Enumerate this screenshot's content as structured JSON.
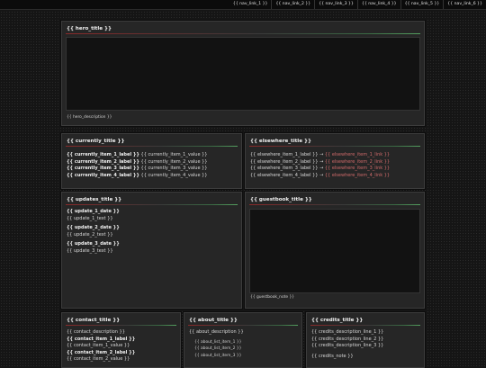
{
  "nav": [
    "{{ nav_link_1 }}",
    "{{ nav_link_2 }}",
    "{{ nav_link_3 }}",
    "{{ nav_link_4 }}",
    "{{ nav_link_5 }}",
    "{{ nav_link_6 }}"
  ],
  "hero": {
    "title": "{{ hero_title }}",
    "description": "{{ hero_description }}"
  },
  "currently": {
    "title": "{{ currently_title }}",
    "items": [
      {
        "label": "{{ currently_item_1_label }}",
        "value": "{{ currently_item_1_value }}"
      },
      {
        "label": "{{ currently_item_2_label }}",
        "value": "{{ currently_item_2_value }}"
      },
      {
        "label": "{{ currently_item_3_label }}",
        "value": "{{ currently_item_3_value }}"
      },
      {
        "label": "{{ currently_item_4_label }}",
        "value": "{{ currently_item_4_value }}"
      }
    ]
  },
  "elsewhere": {
    "title": "{{ elsewhere_title }}",
    "separator": "→",
    "items": [
      {
        "label": "{{ elsewhere_item_1_label }}",
        "link": "{{ elsewhere_item_1_link }}"
      },
      {
        "label": "{{ elsewhere_item_2_label }}",
        "link": "{{ elsewhere_item_2_link }}"
      },
      {
        "label": "{{ elsewhere_item_3_label }}",
        "link": "{{ elsewhere_item_3_link }}"
      },
      {
        "label": "{{ elsewhere_item_4_label }}",
        "link": "{{ elsewhere_item_4_link }}"
      }
    ]
  },
  "updates": {
    "title": "{{ updates_title }}",
    "items": [
      {
        "date": "{{ update_1_date }}",
        "text": "{{ update_1_text }}"
      },
      {
        "date": "{{ update_2_date }}",
        "text": "{{ update_2_text }}"
      },
      {
        "date": "{{ update_3_date }}",
        "text": "{{ update_3_text }}"
      }
    ]
  },
  "guestbook": {
    "title": "{{ guestbook_title }}",
    "note": "{{ guestbook_note }}"
  },
  "contact": {
    "title": "{{ contact_title }}",
    "description": "{{ contact_description }}",
    "items": [
      {
        "label": "{{ contact_item_1_label }}",
        "value": "{{ contact_item_1_value }}"
      },
      {
        "label": "{{ contact_item_2_label }}",
        "value": "{{ contact_item_2_value }}"
      }
    ]
  },
  "about": {
    "title": "{{ about_title }}",
    "description": "{{ about_description }}",
    "list": [
      "{{ about_list_item_1 }}",
      "{{ about_list_item_2 }}",
      "{{ about_list_item_3 }}"
    ]
  },
  "credits": {
    "title": "{{ credits_title }}",
    "lines": [
      "{{ credits_description_line_1 }}",
      "{{ credits_description_line_2 }}",
      "{{ credits_description_line_3 }}"
    ],
    "note": "{{ credits_note }}"
  },
  "colors": {
    "accent_red": "#cf6a6a",
    "accent_green": "#55a060",
    "panel": "#262626",
    "background": "#151515"
  }
}
